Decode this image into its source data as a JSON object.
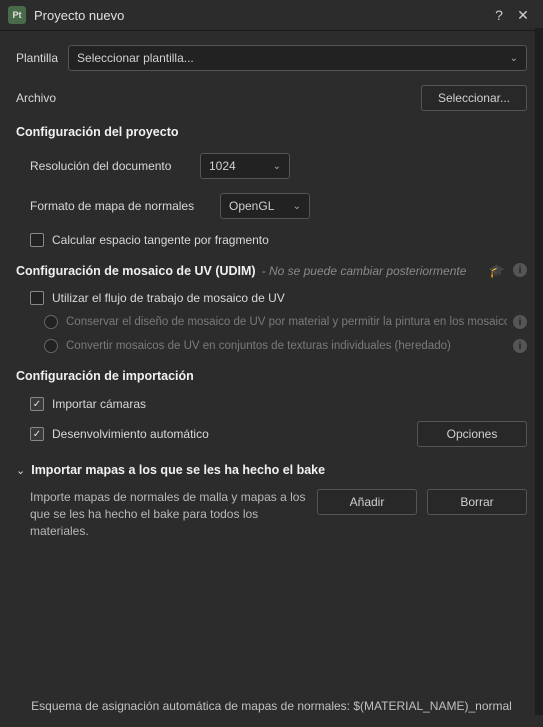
{
  "titlebar": {
    "app_icon": "Pt",
    "title": "Proyecto nuevo",
    "help": "?",
    "close": "✕"
  },
  "template": {
    "label": "Plantilla",
    "placeholder": "Seleccionar plantilla..."
  },
  "file": {
    "label": "Archivo",
    "select_btn": "Seleccionar..."
  },
  "project_config": {
    "head": "Configuración del proyecto",
    "resolution_label": "Resolución del documento",
    "resolution_value": "1024",
    "normals_label": "Formato de mapa de normales",
    "normals_value": "OpenGL",
    "tangent_label": "Calcular espacio tangente por fragmento"
  },
  "udim": {
    "head": "Configuración de mosaico de UV (UDIM)",
    "note": "- No se puede cambiar posteriormente",
    "use_label": "Utilizar el flujo de trabajo de mosaico de UV",
    "opt1": "Conservar el diseño de mosaico de UV por material y permitir la pintura en los mosaicos",
    "opt2": "Convertir mosaicos de UV en conjuntos de texturas individuales (heredado)"
  },
  "import_config": {
    "head": "Configuración de importación",
    "cameras": "Importar cámaras",
    "auto_unwrap": "Desenvolvimiento automático",
    "options_btn": "Opciones"
  },
  "bake": {
    "head": "Importar mapas a los que se les ha hecho el bake",
    "desc": "Importe mapas de normales de malla y mapas a los que se les ha hecho el bake para todos los materiales.",
    "add_btn": "Añadir",
    "clear_btn": "Borrar"
  },
  "footer": {
    "text": "Esquema de asignación automática de mapas de normales: $(MATERIAL_NAME)_normal"
  }
}
